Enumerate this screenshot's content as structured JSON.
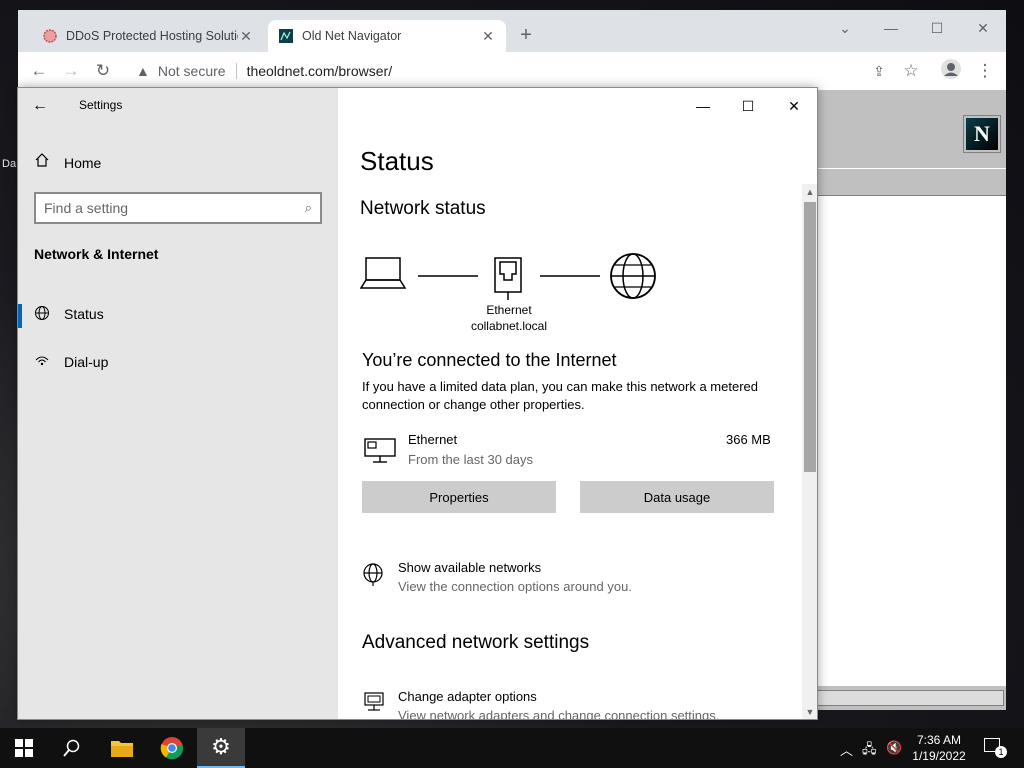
{
  "browser": {
    "tabs": [
      {
        "title": "DDoS Protected Hosting Solutions",
        "active": false
      },
      {
        "title": "Old Net Navigator",
        "active": true
      }
    ],
    "omnibox": {
      "security": "Not secure",
      "url": "theoldnet.com/browser/"
    },
    "page_logo": "N"
  },
  "desktop": {
    "labels": [
      "Da"
    ]
  },
  "settings": {
    "window_title": "Settings",
    "sidebar": {
      "home": "Home",
      "search_placeholder": "Find a setting",
      "section": "Network & Internet",
      "items": [
        {
          "label": "Status",
          "icon": "globe-icon",
          "selected": true
        },
        {
          "label": "Dial-up",
          "icon": "dialup-icon",
          "selected": false
        }
      ]
    },
    "content": {
      "heading": "Status",
      "network_status": "Network status",
      "diagram": {
        "adapter": "Ethernet",
        "network": "collabnet.local"
      },
      "connected": "You’re connected to the Internet",
      "metered_text": "If you have a limited data plan, you can make this network a metered connection or change other properties.",
      "connection": {
        "name": "Ethernet",
        "sub": "From the last 30 days",
        "usage": "366 MB"
      },
      "buttons": {
        "properties": "Properties",
        "data_usage": "Data usage"
      },
      "show_networks": {
        "title": "Show available networks",
        "sub": "View the connection options around you."
      },
      "advanced_heading": "Advanced network settings",
      "adapter_options": {
        "title": "Change adapter options",
        "sub": "View network adapters and change connection settings."
      }
    }
  },
  "taskbar": {
    "clock": {
      "time": "7:36 AM",
      "date": "1/19/2022"
    },
    "notifications": "1"
  }
}
